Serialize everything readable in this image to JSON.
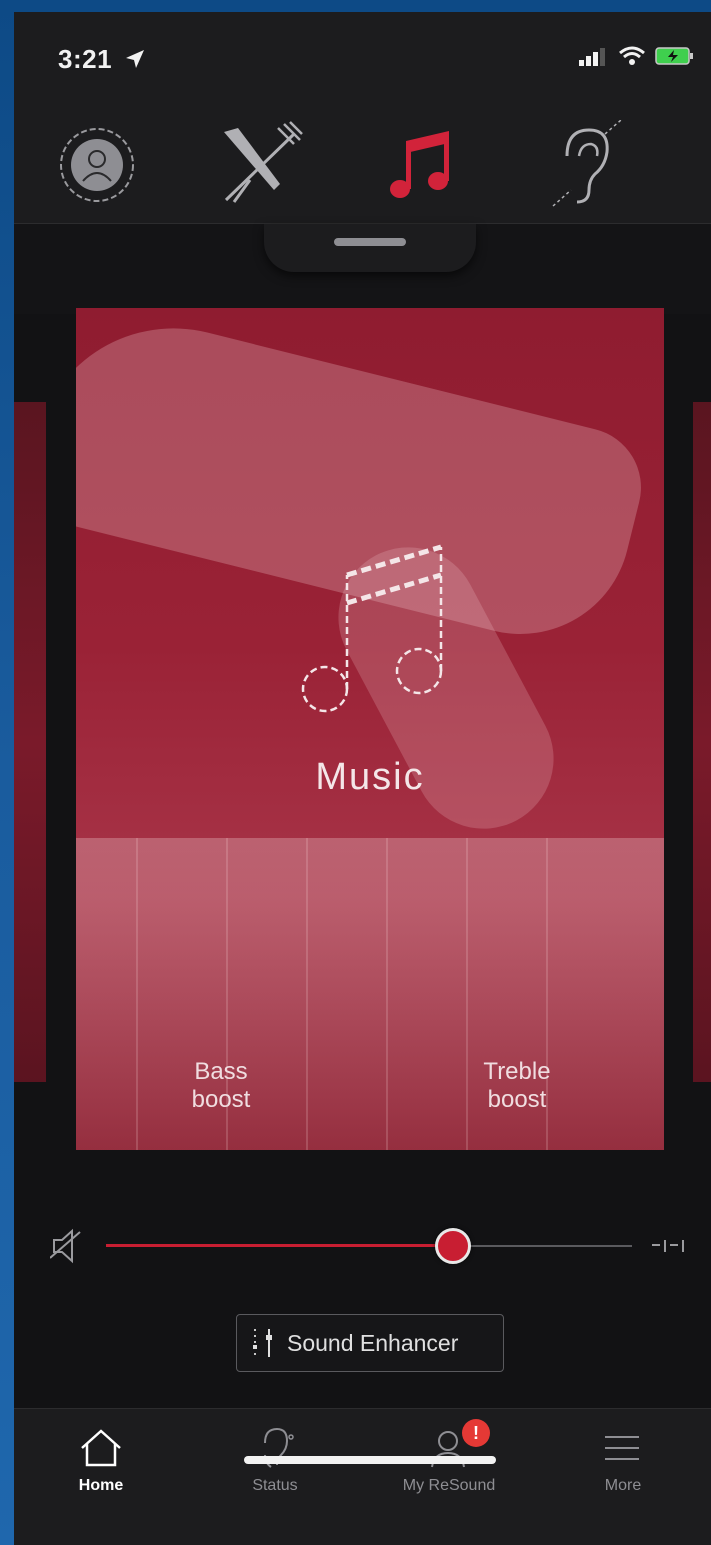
{
  "status_bar": {
    "time": "3:21"
  },
  "programs": [
    {
      "name": "all-around"
    },
    {
      "name": "restaurant"
    },
    {
      "name": "music",
      "active": true
    },
    {
      "name": "hearing-loop"
    }
  ],
  "card": {
    "title": "Music",
    "bass_label": "Bass\nboost",
    "treble_label": "Treble\nboost"
  },
  "volume": {
    "level": 0.66
  },
  "sound_enhancer": {
    "label": "Sound Enhancer"
  },
  "tabs": [
    {
      "label": "Home",
      "active": true
    },
    {
      "label": "Status"
    },
    {
      "label": "My ReSound",
      "badge": "!"
    },
    {
      "label": "More"
    }
  ],
  "colors": {
    "accent": "#c81e32",
    "card": "#9a2236",
    "bar": "#1c1c1e"
  }
}
